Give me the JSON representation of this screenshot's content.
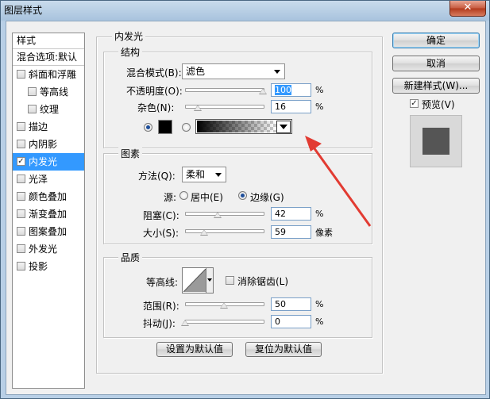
{
  "window": {
    "title": "图层样式",
    "close_glyph": "✕"
  },
  "stylelist": {
    "header": "样式",
    "blending": "混合选项:默认",
    "items": [
      {
        "label": "斜面和浮雕",
        "checked": false
      },
      {
        "label": "等高线",
        "checked": false,
        "indent": true
      },
      {
        "label": "纹理",
        "checked": false,
        "indent": true
      },
      {
        "label": "描边",
        "checked": false
      },
      {
        "label": "内阴影",
        "checked": false
      },
      {
        "label": "内发光",
        "checked": true,
        "selected": true
      },
      {
        "label": "光泽",
        "checked": false
      },
      {
        "label": "颜色叠加",
        "checked": false
      },
      {
        "label": "渐变叠加",
        "checked": false
      },
      {
        "label": "图案叠加",
        "checked": false
      },
      {
        "label": "外发光",
        "checked": false
      },
      {
        "label": "投影",
        "checked": false
      }
    ]
  },
  "panel": {
    "title": "内发光",
    "structure": {
      "title": "结构",
      "blend_label": "混合模式(B):",
      "blend_value": "滤色",
      "opacity_label": "不透明度(O):",
      "opacity_value": "100",
      "opacity_unit": "%",
      "opacity_pct": 100,
      "noise_label": "杂色(N):",
      "noise_value": "16",
      "noise_unit": "%",
      "noise_pct": 16,
      "color_hex": "#000000"
    },
    "elements": {
      "title": "图素",
      "method_label": "方法(Q):",
      "method_value": "柔和",
      "source_label": "源:",
      "source_center": "居中(E)",
      "source_edge": "边缘(G)",
      "choke_label": "阻塞(C):",
      "choke_value": "42",
      "choke_unit": "%",
      "choke_pct": 42,
      "size_label": "大小(S):",
      "size_value": "59",
      "size_unit": "像素",
      "size_pct": 24
    },
    "quality": {
      "title": "品质",
      "contour_label": "等高线:",
      "antialias_label": "消除锯齿(L)",
      "range_label": "范围(R):",
      "range_value": "50",
      "range_unit": "%",
      "range_pct": 50,
      "jitter_label": "抖动(J):",
      "jitter_value": "0",
      "jitter_unit": "%",
      "jitter_pct": 0
    },
    "set_default": "设置为默认值",
    "reset_default": "复位为默认值"
  },
  "buttons": {
    "ok": "确定",
    "cancel": "取消",
    "new_style": "新建样式(W)..."
  },
  "preview": {
    "label": "预览(V)",
    "checked": true
  },
  "colors": {
    "accent": "#3399ff",
    "arrow": "#e23b32",
    "swatch": "#555555"
  }
}
